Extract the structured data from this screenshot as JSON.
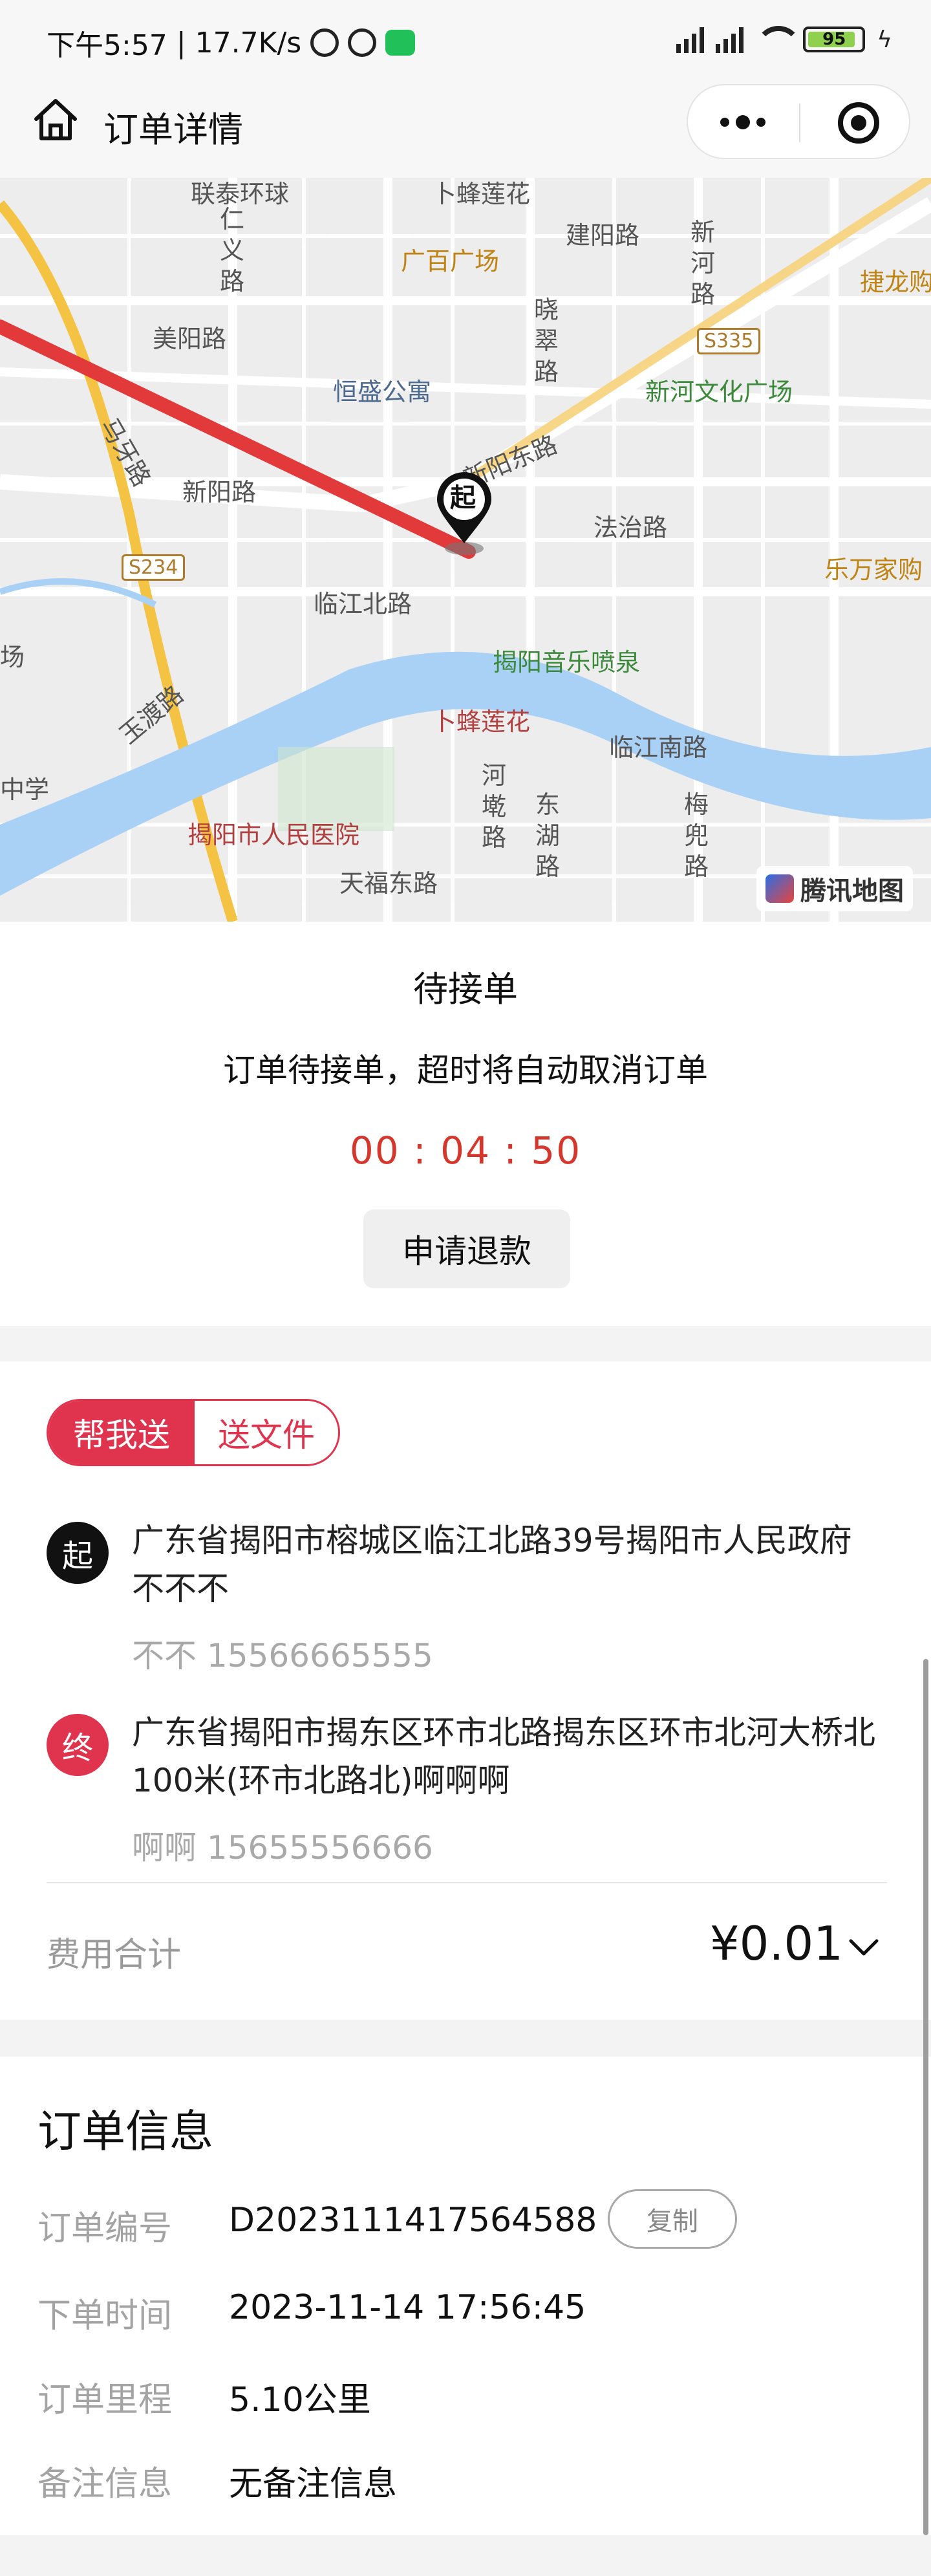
{
  "status_bar": {
    "time": "下午5:57",
    "net_speed": "17.7K/s",
    "battery_level": "95",
    "icons": [
      "mute-icon",
      "alarm-icon",
      "wechat-icon",
      "signal-icon",
      "wifi-icon",
      "battery-icon",
      "charging-icon"
    ]
  },
  "nav": {
    "title": "订单详情",
    "home_icon": "home-icon",
    "more_icon": "more-icon",
    "close_icon": "target-icon"
  },
  "map": {
    "labels": {
      "lianxin": "联泰环球",
      "bufeng_top": "卜蜂莲花",
      "renyi": "仁义路",
      "guangbai": "广百广场",
      "jianyang": "建阳路",
      "xinhe": "新河路",
      "jielong": "捷龙购",
      "meiyang": "美阳路",
      "xiaocui": "晓翠路",
      "s335": "S335",
      "hengsheng": "恒盛公寓",
      "xinhe_culture": "新河文化广场",
      "maqiao": "马牙路",
      "xinyang": "新阳路",
      "yangdong": "新阳东路",
      "fazhi": "法治路",
      "lewan": "乐万家购",
      "s234": "S234",
      "linjiang_n": "临江北路",
      "chang": "场",
      "music_fountain": "揭阳音乐喷泉",
      "yudu": "玉渡路",
      "bufeng_mid": "卜蜂莲花",
      "linjiang_s": "临江南路",
      "zhongxue": "中学",
      "heshu": "河墘路",
      "donghu": "东湖路",
      "meidou": "梅兜路",
      "hospital": "揭阳市人民医院",
      "tianfu": "天福东路",
      "map_brand": "腾讯地图",
      "start_pin": "起"
    }
  },
  "order_status": {
    "title": "待接单",
    "description": "订单待接单，超时将自动取消订单",
    "countdown": "00 : 04 : 50",
    "refund_button": "申请退款"
  },
  "delivery": {
    "service_tag": "帮我送",
    "category_tag": "送文件",
    "start": {
      "badge": "起",
      "address": "广东省揭阳市榕城区临江北路39号揭阳市人民政府不不不",
      "contact": "不不 15566665555"
    },
    "end": {
      "badge": "终",
      "address": "广东省揭阳市揭东区环市北路揭东区环市北河大桥北100米(环市北路北)啊啊啊",
      "contact": "啊啊 15655556666"
    },
    "fee_label": "费用合计",
    "fee_value": "¥0.01"
  },
  "order_info": {
    "title": "订单信息",
    "rows": [
      {
        "label": "订单编号",
        "value": "D2023111417564588"
      },
      {
        "label": "下单时间",
        "value": "2023-11-14 17:56:45"
      },
      {
        "label": "订单里程",
        "value": "5.10公里"
      },
      {
        "label": "备注信息",
        "value": "无备注信息"
      }
    ],
    "copy_button": "复制"
  },
  "colors": {
    "accent_red": "#e0334d",
    "countdown_red": "#d6372c",
    "route_red": "#e2393b",
    "river_blue": "#a9d0f5"
  }
}
